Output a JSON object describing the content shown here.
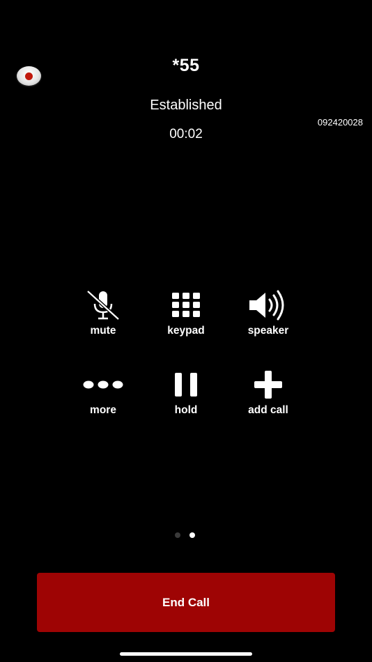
{
  "call": {
    "number": "*55",
    "status": "Established",
    "timer": "00:02",
    "account_number": "092420028"
  },
  "controls": {
    "mute": {
      "label": "mute",
      "icon": "mic-muted-icon"
    },
    "keypad": {
      "label": "keypad",
      "icon": "keypad-icon"
    },
    "speaker": {
      "label": "speaker",
      "icon": "speaker-icon"
    },
    "more": {
      "label": "more",
      "icon": "more-dots-icon"
    },
    "hold": {
      "label": "hold",
      "icon": "pause-icon"
    },
    "add_call": {
      "label": "add call",
      "icon": "plus-icon"
    }
  },
  "pager": {
    "page_count": 2,
    "active_page": 2
  },
  "end_call": {
    "label": "End Call",
    "color": "#9e0404"
  },
  "record": {
    "icon": "record-icon",
    "dot_color": "#c0180c"
  }
}
